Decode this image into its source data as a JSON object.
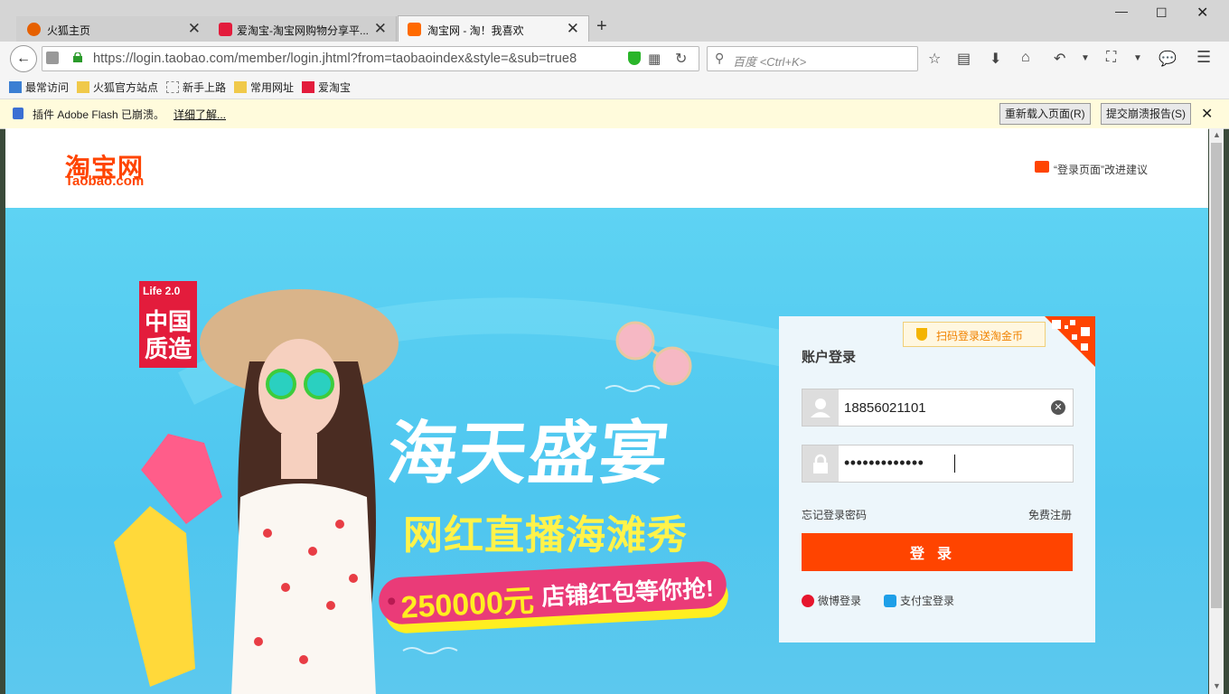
{
  "browser": {
    "tabs": [
      {
        "title": "火狐主页",
        "favicon_color": "#e66000"
      },
      {
        "title": "爱淘宝-淘宝网购物分享平...",
        "favicon_color": "#e31c3c"
      },
      {
        "title": "淘宝网 - 淘！我喜欢",
        "favicon_color": "#ff6a00"
      }
    ],
    "url": "https://login.taobao.com/member/login.jhtml?from=taobaoindex&style=&sub=true8",
    "search_placeholder": "百度 <Ctrl+K>",
    "bookmarks": [
      "最常访问",
      "火狐官方站点",
      "新手上路",
      "常用网址",
      "爱淘宝"
    ],
    "notice": {
      "text": "插件 Adobe Flash 已崩溃。",
      "link": "详细了解...",
      "reload_button": "重新载入页面(R)",
      "report_button": "提交崩溃报告(S)"
    }
  },
  "page": {
    "logo": {
      "cn": "淘宝网",
      "en": "Taobao.com"
    },
    "suggestion": "“登录页面”改进建议",
    "banner": {
      "badge_top": "Life 2.0",
      "badge_main": "中国质造",
      "headline": "海天盛宴",
      "subline": "网红直播海滩秀",
      "amount": "250000元",
      "promo": "店铺红包等你抢!"
    },
    "login": {
      "qr_tip": "扫码登录送淘金币",
      "title": "账户登录",
      "username": "18856021101",
      "password": "•••••••••••••",
      "forgot": "忘记登录密码",
      "register": "免费注册",
      "submit": "登录",
      "weibo": "微博登录",
      "alipay": "支付宝登录"
    },
    "colors": {
      "brand": "#ff4400",
      "banner_bg": "#4ec6ef"
    }
  }
}
